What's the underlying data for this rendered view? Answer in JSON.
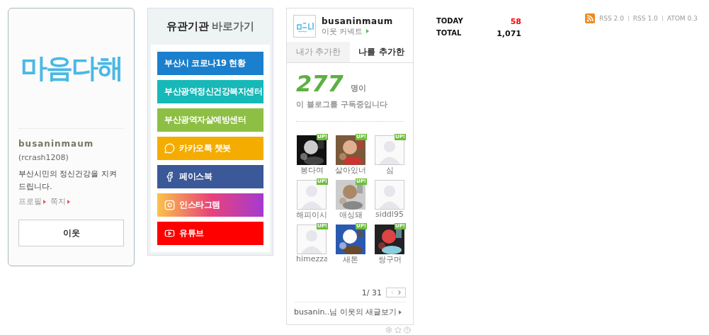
{
  "profile": {
    "logo": "마음다해",
    "name": "busaninmaum",
    "id": "(rcrash1208)",
    "description": "부산시민의 정신건강을 지켜드립니다.",
    "links": [
      "프로필",
      "쪽지"
    ],
    "button": "이웃"
  },
  "shortcuts": {
    "title": "유관기관",
    "title_accent": "바로가기",
    "items": [
      {
        "label": "부산시 코로나19 현황",
        "kind": "plain",
        "color": "#1a7fcc"
      },
      {
        "label": "부산광역정신건강복지센터",
        "kind": "plain",
        "color": "#17b8b8"
      },
      {
        "label": "부산광역자살예방센터",
        "kind": "plain",
        "color": "#8cbf44"
      },
      {
        "label": "카카오톡 챗봇",
        "kind": "chat",
        "color": "#f5ac00"
      },
      {
        "label": "페이스북",
        "kind": "facebook",
        "color": "#3b5898"
      },
      {
        "label": "인스타그램",
        "kind": "instagram",
        "color": "#e8437a"
      },
      {
        "label": "유튜브",
        "kind": "youtube",
        "color": "#ff0000"
      }
    ]
  },
  "neighbors": {
    "name": "busaninmaum",
    "connect": "이웃 커넥트",
    "tabs": [
      {
        "label": "내가 추가한",
        "selected": false
      },
      {
        "label": "나를 추가한",
        "selected": true
      }
    ],
    "count": "277",
    "count_unit": "명이",
    "count_caption": "이 블로그를 구독중입니다",
    "friends": [
      {
        "name": "봉다여",
        "kind": "moon",
        "badge": "UP!"
      },
      {
        "name": "살아있너",
        "kind": "people",
        "badge": "UP!"
      },
      {
        "name": "심",
        "kind": "silhouette",
        "badge": "UP!"
      },
      {
        "name": "해피이시",
        "kind": "silhouette",
        "badge": "UP!"
      },
      {
        "name": "애싱돼",
        "kind": "animal",
        "badge": "UP!"
      },
      {
        "name": "siddl95",
        "kind": "silhouette"
      },
      {
        "name": "himezza",
        "kind": "silhouette",
        "badge": "UP!"
      },
      {
        "name": "새톤",
        "kind": "sky",
        "badge": "UP!"
      },
      {
        "name": "쌍구머",
        "kind": "octopus",
        "badge": "UP!"
      }
    ],
    "page": "1/ 31",
    "footer": "busanin..님 이웃의 새글보기"
  },
  "stats": [
    {
      "label": "TODAY",
      "value": "58",
      "kind": "today"
    },
    {
      "label": "TOTAL",
      "value": "1,071",
      "kind": "total"
    }
  ],
  "feeds": [
    "RSS 2.0",
    "RSS 1.0",
    "ATOM 0.3"
  ]
}
